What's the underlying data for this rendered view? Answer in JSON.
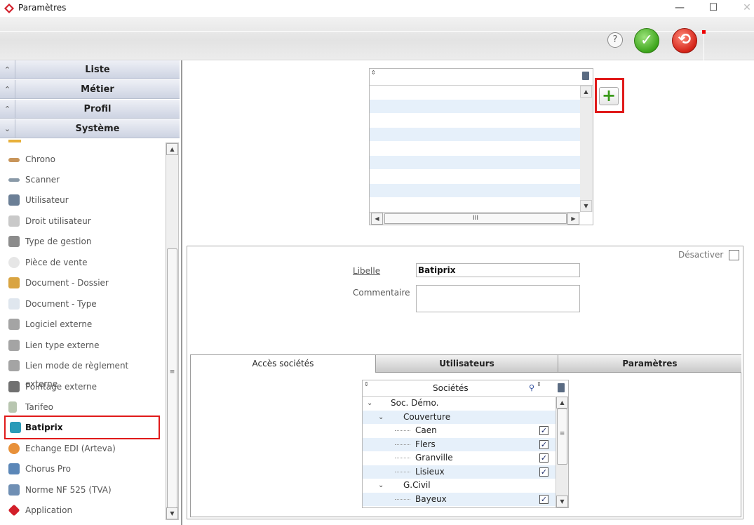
{
  "window": {
    "title": "Paramètres",
    "minimize": "—",
    "maximize": "☐",
    "close": "✕"
  },
  "toolbar": {
    "help": "?",
    "ok": "✓",
    "cancel": "⟲",
    "colors": {
      "ok": "#3da51c",
      "cancel": "#d42418"
    }
  },
  "sidebar": {
    "sections": [
      {
        "label": "Liste",
        "chevron": "⌃"
      },
      {
        "label": "Métier",
        "chevron": "⌃"
      },
      {
        "label": "Profil",
        "chevron": "⌃"
      },
      {
        "label": "Système",
        "chevron": "⌄"
      }
    ],
    "items": [
      {
        "label": "Chrono",
        "icon": "chrono-icon"
      },
      {
        "label": "Scanner",
        "icon": "scanner-icon"
      },
      {
        "label": "Utilisateur",
        "icon": "user-icon"
      },
      {
        "label": "Droit utilisateur",
        "icon": "lock-icon"
      },
      {
        "label": "Type de gestion",
        "icon": "tag-icon"
      },
      {
        "label": "Pièce de vente",
        "icon": "coin-icon"
      },
      {
        "label": "Document - Dossier",
        "icon": "folder-icon"
      },
      {
        "label": "Document - Type",
        "icon": "document-icon"
      },
      {
        "label": "Logiciel externe",
        "icon": "disk-icon"
      },
      {
        "label": "Lien type externe",
        "icon": "disk-icon"
      },
      {
        "label": "Lien mode de règlement externe",
        "icon": "disk-icon"
      },
      {
        "label": "Pointage externe",
        "icon": "camera-icon"
      },
      {
        "label": "Tarifeo",
        "icon": "tarifeo-icon"
      },
      {
        "label": "Batiprix",
        "icon": "cube-icon",
        "selected": true
      },
      {
        "label": "Echange EDI (Arteva)",
        "icon": "edi-icon"
      },
      {
        "label": "Chorus Pro",
        "icon": "network-icon"
      },
      {
        "label": "Norme NF 525 (TVA)",
        "icon": "norm-icon"
      },
      {
        "label": "Application",
        "icon": "app-icon"
      }
    ]
  },
  "form": {
    "deactivate_label": "Désactiver",
    "libelle_label": "Libelle",
    "libelle_value": "Batiprix",
    "comment_label": "Commentaire",
    "comment_value": "",
    "tabs": [
      {
        "label": "Accès sociétés",
        "active": true
      },
      {
        "label": "Utilisateurs",
        "active": false
      },
      {
        "label": "Paramètres",
        "active": false
      }
    ],
    "tree": {
      "header": "Sociétés",
      "rows": [
        {
          "label": "Soc. Démo.",
          "level": 0,
          "expander": "⌄",
          "checkbox": false,
          "checked": false
        },
        {
          "label": "Couverture",
          "level": 1,
          "expander": "⌄",
          "checkbox": false,
          "checked": false
        },
        {
          "label": "Caen",
          "level": 2,
          "expander": "",
          "checkbox": true,
          "checked": true
        },
        {
          "label": "Flers",
          "level": 2,
          "expander": "",
          "checkbox": true,
          "checked": true
        },
        {
          "label": "Granville",
          "level": 2,
          "expander": "",
          "checkbox": true,
          "checked": true
        },
        {
          "label": "Lisieux",
          "level": 2,
          "expander": "",
          "checkbox": true,
          "checked": true
        },
        {
          "label": "G.Civil",
          "level": 1,
          "expander": "⌄",
          "checkbox": false,
          "checked": false
        },
        {
          "label": "Bayeux",
          "level": 2,
          "expander": "",
          "checkbox": true,
          "checked": true
        }
      ]
    }
  },
  "colors": {
    "highlight": "#e01a1a",
    "add_plus": "#3a9a1a",
    "row_alt": "#e6f0fa"
  }
}
